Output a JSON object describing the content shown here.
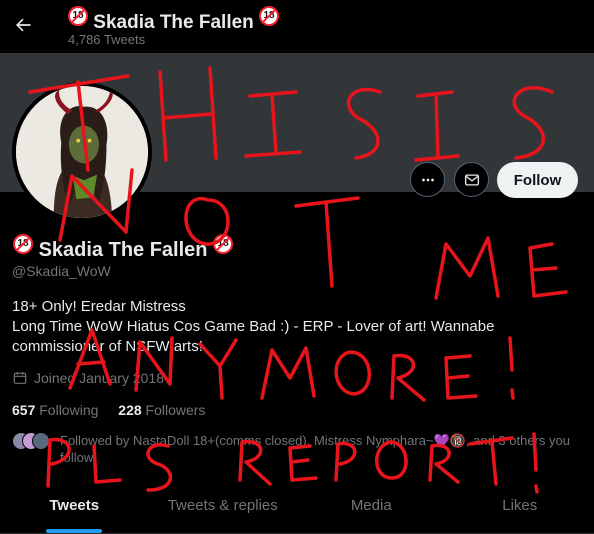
{
  "header": {
    "title": "Skadia The Fallen",
    "title_prefix_badge": "18",
    "title_suffix_badge": "18",
    "tweet_count": "4,786 Tweets"
  },
  "icons": {
    "back": "arrow-left-icon",
    "more": "more-dots-icon",
    "message": "envelope-icon",
    "calendar": "calendar-icon"
  },
  "actions": {
    "follow_label": "Follow"
  },
  "profile": {
    "display_name": "Skadia The Fallen",
    "name_prefix_badge": "18",
    "name_suffix_badge": "18",
    "handle": "@Skadia_WoW",
    "bio_line1": "18+ Only! Eredar Mistress",
    "bio_line2": "Long Time WoW Hiatus Cos Game Bad :) - ERP - Lover of art! Wannabe",
    "bio_line3": "commissioner of NSFW arts!",
    "joined": "Joined January 2018",
    "following_count": "657",
    "following_label": "Following",
    "followers_count": "228",
    "followers_label": "Followers",
    "followed_by": "Followed by NastaDoll 18+(comms closed), Mistress Nymphara~💜🔞, and 3 others you follow"
  },
  "tabs": [
    {
      "label": "Tweets",
      "active": true
    },
    {
      "label": "Tweets & replies",
      "active": false
    },
    {
      "label": "Media",
      "active": false
    },
    {
      "label": "Likes",
      "active": false
    }
  ],
  "overlay_text": {
    "line1": "THIS IS",
    "line2": "NOT ME",
    "line3": "ANYMORE!",
    "line4": "PLS REPORT!"
  },
  "colors": {
    "background": "#000000",
    "banner": "#333639",
    "accent": "#1d9bf0",
    "scribble": "#e8141c",
    "muted": "#71767b"
  }
}
